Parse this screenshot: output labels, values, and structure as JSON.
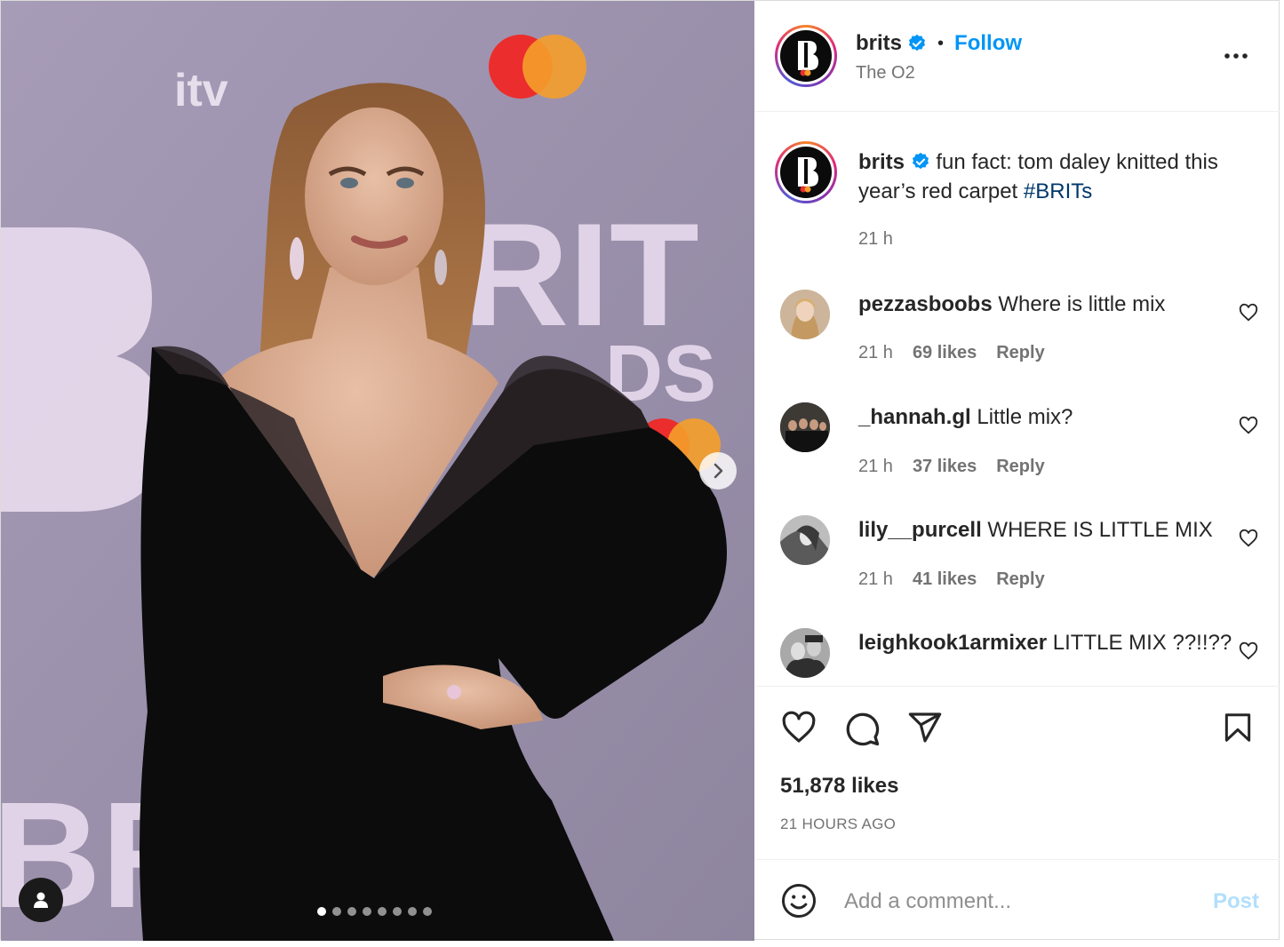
{
  "post": {
    "username": "brits",
    "follow_label": "Follow",
    "separator": "•",
    "location": "The O2",
    "caption_text": "fun fact: tom daley knitted this year’s red carpet",
    "caption_hashtag": "#BRITs",
    "caption_time": "21 h",
    "likes": "51,878 likes",
    "posted_ago": "21 HOURS AGO"
  },
  "media": {
    "carousel_count": 8,
    "carousel_active_index": 0
  },
  "comments": [
    {
      "username": "pezzasboobs",
      "text": "Where is little mix",
      "time": "21 h",
      "likes": "69 likes",
      "reply": "Reply"
    },
    {
      "username": "_hannah.gl",
      "text": "Little mix?",
      "time": "21 h",
      "likes": "37 likes",
      "reply": "Reply"
    },
    {
      "username": "lily__purcell",
      "text": "WHERE IS LITTLE MIX",
      "time": "21 h",
      "likes": "41 likes",
      "reply": "Reply"
    },
    {
      "username": "leighkook1armixer",
      "text": "LITTLE MIX ??!!??",
      "time": "",
      "likes": "",
      "reply": ""
    }
  ],
  "add_comment": {
    "placeholder": "Add a comment...",
    "post_label": "Post"
  },
  "colors": {
    "link_blue": "#0095f6",
    "post_disabled": "#b2dffc",
    "hashtag": "#00376b",
    "muted": "#737373"
  },
  "icons": [
    "verified-badge-icon",
    "more-options-icon",
    "heart-icon",
    "comment-icon",
    "share-icon",
    "bookmark-icon",
    "emoji-icon",
    "chevron-right-icon",
    "user-tag-icon"
  ]
}
